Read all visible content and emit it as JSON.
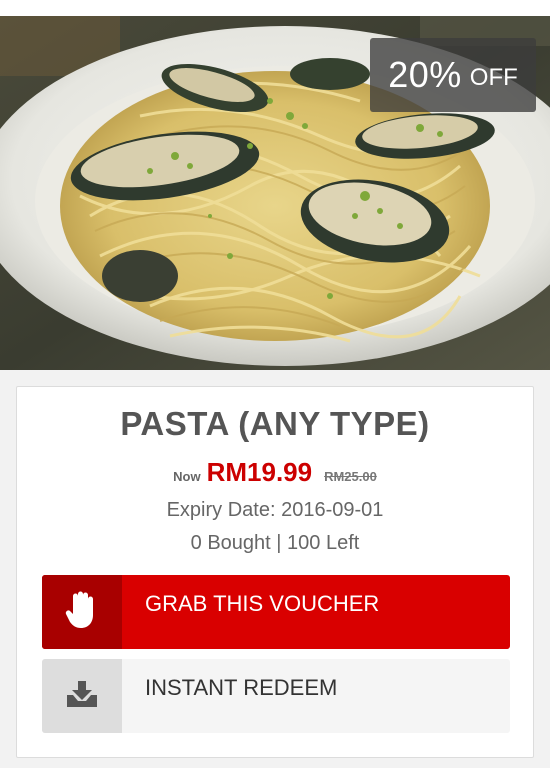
{
  "deal": {
    "discount_value": "20%",
    "discount_label": "OFF",
    "title": "PASTA (ANY TYPE)",
    "price_now_label": "Now",
    "price_now": "RM19.99",
    "price_original": "RM25.00",
    "expiry_text": "Expiry Date: 2016-09-01",
    "stock_text": "0 Bought | 100 Left"
  },
  "actions": {
    "grab_label": "GRAB THIS VOUCHER",
    "grab_icon": "hand-icon",
    "redeem_label": "INSTANT REDEEM",
    "redeem_icon": "download-tray-icon"
  },
  "colors": {
    "accent_red": "#d90000",
    "accent_red_dark": "#a80000",
    "price_red": "#cc0000",
    "text_gray": "#555555"
  },
  "image": {
    "subject": "plate of spaghetti with mussels"
  }
}
